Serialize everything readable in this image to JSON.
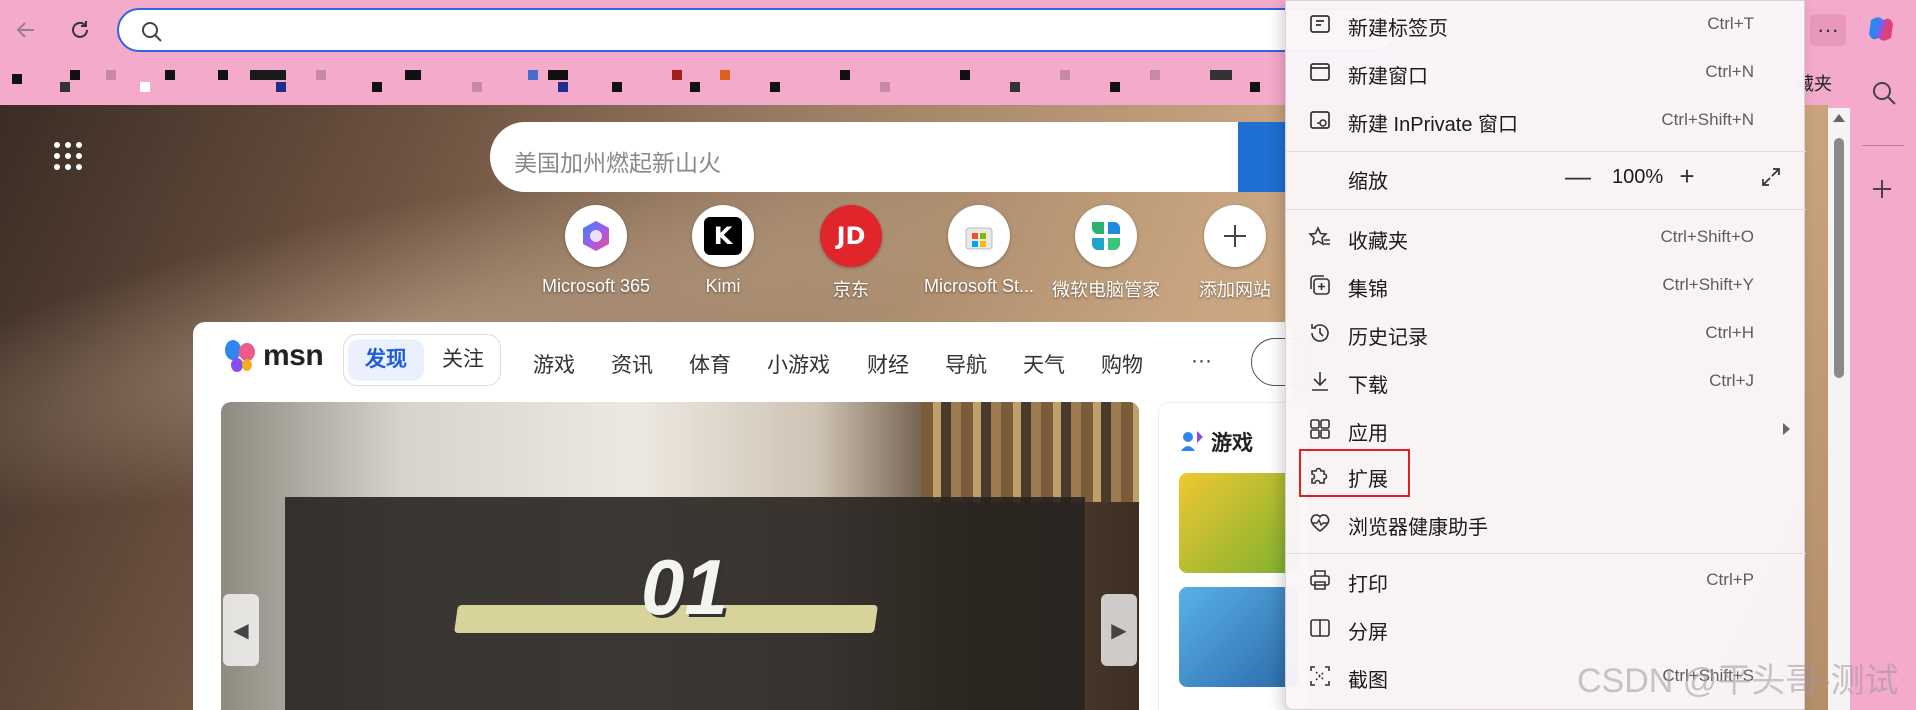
{
  "colors": {
    "accent": "#2f66e0",
    "sidebar": "#f4aacb",
    "highlight": "#e02020",
    "msn_blue": "#1f5cd6"
  },
  "toolbar": {
    "back_icon": "arrow-left-icon",
    "refresh_icon": "refresh-icon",
    "address_placeholder": "",
    "more_icon": "more-horizontal-icon",
    "more_label": "···",
    "copilot_icon": "copilot-icon"
  },
  "favorites": {
    "visible_tail": "藏夹"
  },
  "sidebar": {
    "icons": [
      "search-icon",
      "add-icon"
    ]
  },
  "msn": {
    "search_placeholder": "美国加州燃起新山火",
    "quick_links": [
      {
        "label": "Microsoft 365",
        "icon": "microsoft-365-icon"
      },
      {
        "label": "Kimi",
        "icon": "kimi-icon"
      },
      {
        "label": "京东",
        "icon": "jd-icon"
      },
      {
        "label": "Microsoft St...",
        "icon": "microsoft-store-icon"
      },
      {
        "label": "微软电脑管家",
        "icon": "pc-manager-icon"
      },
      {
        "label": "添加网站",
        "icon": "add-icon"
      }
    ],
    "logo_text": "msn",
    "segments": {
      "active": "发现",
      "inactive": "关注"
    },
    "nav": [
      "游戏",
      "资讯",
      "体育",
      "小游戏",
      "财经",
      "导航",
      "天气",
      "购物",
      "···"
    ],
    "hero_number": "01",
    "side_title": "游戏"
  },
  "menu": {
    "items": [
      {
        "label": "新建标签页",
        "shortcut": "Ctrl+T",
        "icon": "new-tab-icon"
      },
      {
        "label": "新建窗口",
        "shortcut": "Ctrl+N",
        "icon": "new-window-icon"
      },
      {
        "label": "新建 InPrivate 窗口",
        "shortcut": "Ctrl+Shift+N",
        "icon": "inprivate-icon"
      },
      {
        "label": "缩放",
        "icon": ""
      },
      {
        "label": "收藏夹",
        "shortcut": "Ctrl+Shift+O",
        "icon": "favorites-icon"
      },
      {
        "label": "集锦",
        "shortcut": "Ctrl+Shift+Y",
        "icon": "collections-icon"
      },
      {
        "label": "历史记录",
        "shortcut": "Ctrl+H",
        "icon": "history-icon"
      },
      {
        "label": "下载",
        "shortcut": "Ctrl+J",
        "icon": "download-icon"
      },
      {
        "label": "应用",
        "icon": "apps-icon"
      },
      {
        "label": "扩展",
        "icon": "extensions-icon"
      },
      {
        "label": "浏览器健康助手",
        "icon": "browser-health-icon"
      },
      {
        "label": "打印",
        "shortcut": "Ctrl+P",
        "icon": "print-icon"
      },
      {
        "label": "分屏",
        "icon": "split-screen-icon"
      },
      {
        "label": "截图",
        "shortcut": "Ctrl+Shift+S",
        "icon": "screenshot-icon"
      }
    ],
    "zoom": {
      "minus": "—",
      "value": "100%",
      "plus": "+"
    }
  },
  "watermark": "CSDN @平头哥-测试"
}
